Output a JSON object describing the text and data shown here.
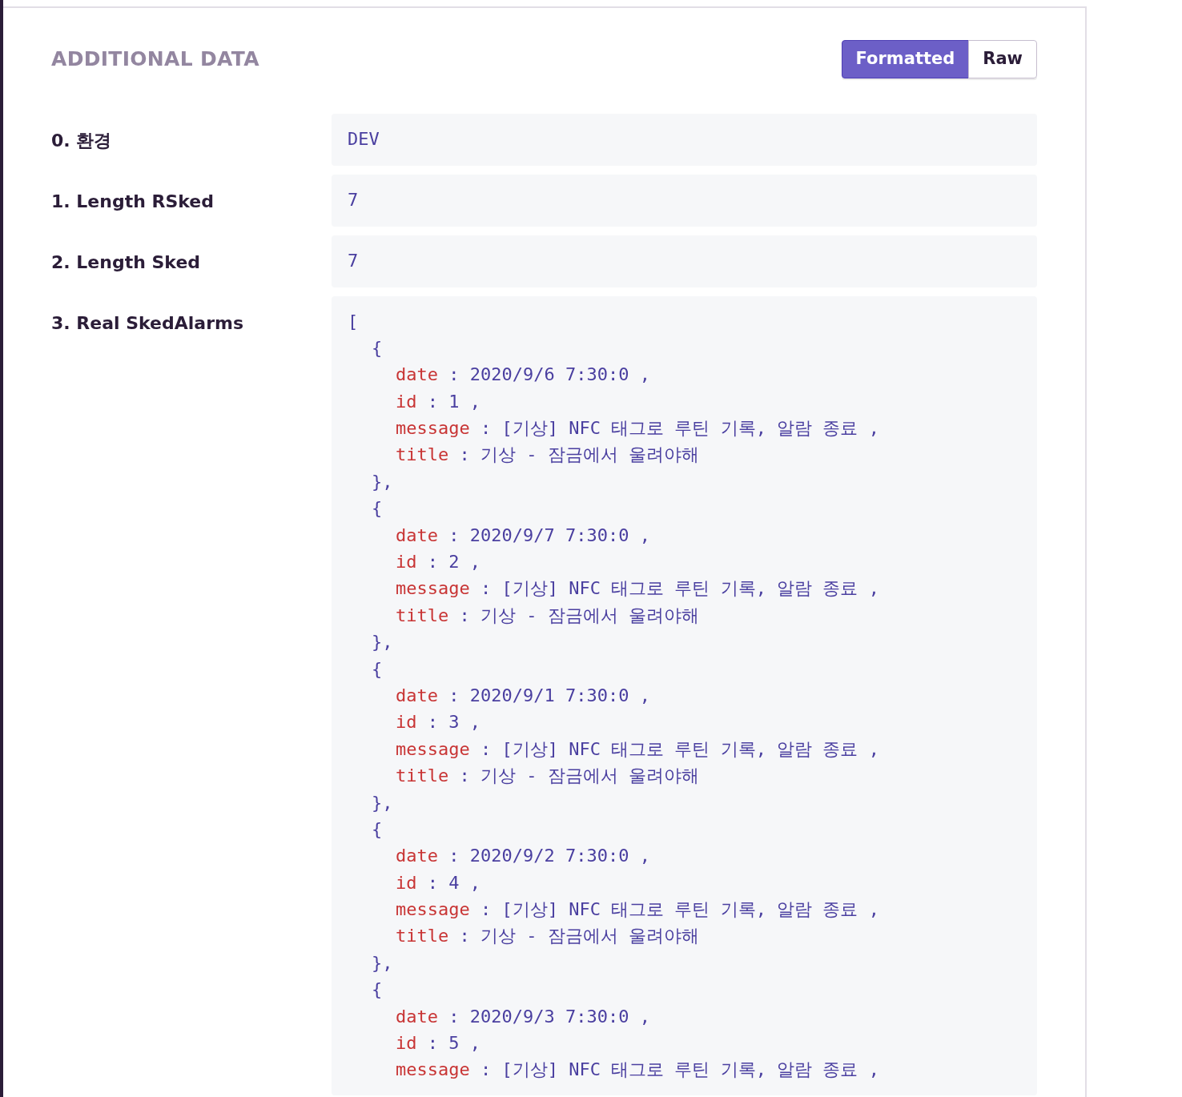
{
  "section": {
    "title": "ADDITIONAL DATA",
    "view_toggle": [
      {
        "label": "Formatted",
        "selected": true
      },
      {
        "label": "Raw",
        "selected": false
      }
    ],
    "rows": [
      {
        "kind": "text",
        "key": "0. 환경",
        "value": "DEV"
      },
      {
        "kind": "text",
        "key": "1. Length RSked",
        "value": "7"
      },
      {
        "kind": "text",
        "key": "2. Length Sked",
        "value": "7"
      },
      {
        "kind": "array",
        "key": "3. Real SkedAlarms",
        "open": "[",
        "items": [
          {
            "open": "{",
            "close": "},",
            "fields": [
              {
                "key": "date",
                "colon": ":",
                "value": "2020/9/6 7:30:0",
                "comma": ","
              },
              {
                "key": "id",
                "colon": ":",
                "value": "1",
                "comma": ","
              },
              {
                "key": "message",
                "colon": ":",
                "value": "[기상] NFC 태그로 루틴 기록, 알람 종료",
                "comma": ","
              },
              {
                "key": "title",
                "colon": ":",
                "value": "기상 - 잠금에서 울려야해"
              }
            ]
          },
          {
            "open": "{",
            "close": "},",
            "fields": [
              {
                "key": "date",
                "colon": ":",
                "value": "2020/9/7 7:30:0",
                "comma": ","
              },
              {
                "key": "id",
                "colon": ":",
                "value": "2",
                "comma": ","
              },
              {
                "key": "message",
                "colon": ":",
                "value": "[기상] NFC 태그로 루틴 기록, 알람 종료",
                "comma": ","
              },
              {
                "key": "title",
                "colon": ":",
                "value": "기상 - 잠금에서 울려야해"
              }
            ]
          },
          {
            "open": "{",
            "close": "},",
            "fields": [
              {
                "key": "date",
                "colon": ":",
                "value": "2020/9/1 7:30:0",
                "comma": ","
              },
              {
                "key": "id",
                "colon": ":",
                "value": "3",
                "comma": ","
              },
              {
                "key": "message",
                "colon": ":",
                "value": "[기상] NFC 태그로 루틴 기록, 알람 종료",
                "comma": ","
              },
              {
                "key": "title",
                "colon": ":",
                "value": "기상 - 잠금에서 울려야해"
              }
            ]
          },
          {
            "open": "{",
            "close": "},",
            "fields": [
              {
                "key": "date",
                "colon": ":",
                "value": "2020/9/2 7:30:0",
                "comma": ","
              },
              {
                "key": "id",
                "colon": ":",
                "value": "4",
                "comma": ","
              },
              {
                "key": "message",
                "colon": ":",
                "value": "[기상] NFC 태그로 루틴 기록, 알람 종료",
                "comma": ","
              },
              {
                "key": "title",
                "colon": ":",
                "value": "기상 - 잠금에서 울려야해"
              }
            ]
          },
          {
            "open": "{",
            "fields": [
              {
                "key": "date",
                "colon": ":",
                "value": "2020/9/3 7:30:0",
                "comma": ","
              },
              {
                "key": "id",
                "colon": ":",
                "value": "5",
                "comma": ","
              },
              {
                "key": "message",
                "colon": ":",
                "value": "[기상] NFC 태그로 루틴 기록, 알람 종료",
                "comma": ","
              }
            ]
          }
        ]
      }
    ]
  }
}
